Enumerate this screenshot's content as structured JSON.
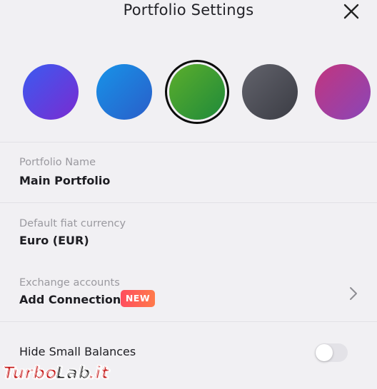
{
  "header": {
    "title": "Portfolio Settings",
    "close_icon": "close-icon"
  },
  "swatches": [
    {
      "name": "purple-blue",
      "from": "#3b5bf0",
      "to": "#7a2bd1",
      "selected": false
    },
    {
      "name": "blue",
      "from": "#1793e8",
      "to": "#2a5ec9",
      "selected": false
    },
    {
      "name": "green",
      "from": "#5cae2c",
      "to": "#1f8a3a",
      "selected": true
    },
    {
      "name": "gray",
      "from": "#62636c",
      "to": "#3b3c44",
      "selected": false
    },
    {
      "name": "magenta",
      "from": "#c2357e",
      "to": "#8a46b8",
      "selected": false
    }
  ],
  "portfolio_name": {
    "label": "Portfolio Name",
    "value": "Main Portfolio"
  },
  "fiat_currency": {
    "label": "Default fiat currency",
    "value": "Euro (EUR)"
  },
  "exchange": {
    "label": "Exchange accounts",
    "action": "Add Connection",
    "badge": "NEW",
    "icon": "chevron-right-icon"
  },
  "hide_small": {
    "label": "Hide Small Balances",
    "enabled": false
  },
  "watermark": {
    "text": "TurboLab.it"
  }
}
